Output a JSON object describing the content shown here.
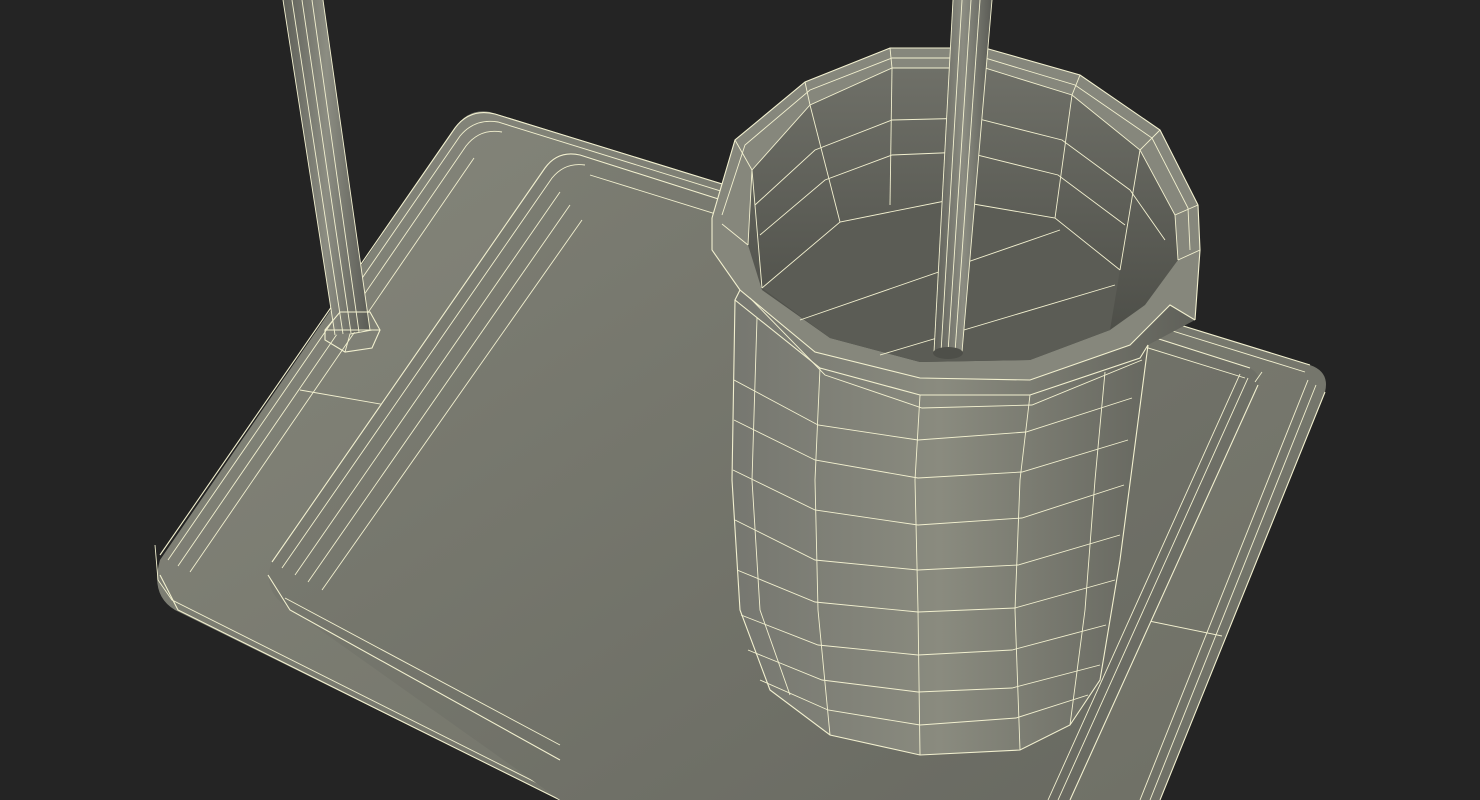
{
  "scene": {
    "subject": "wireframe-3d-model",
    "background_color": "#242424",
    "mesh_color": "#7a7b70",
    "wire_color": "#f2f0cf",
    "objects": [
      "base-plate",
      "raised-pad",
      "support-rod",
      "rod-collar",
      "cup",
      "cup-rod"
    ]
  }
}
